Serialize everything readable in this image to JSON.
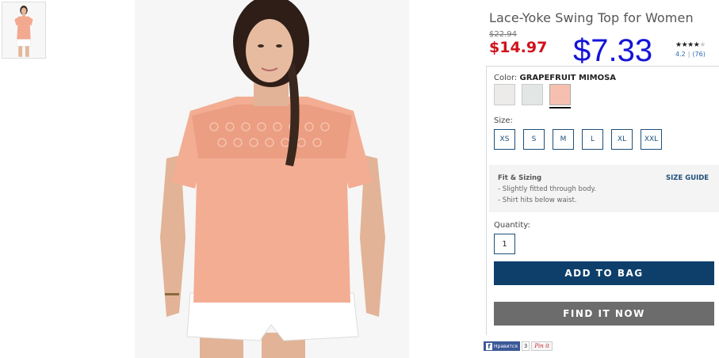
{
  "product": {
    "title": "Lace-Yoke Swing Top for Women",
    "original_price": "$22.94",
    "sale_price": "$14.97",
    "overlay_price": "$7.33",
    "rating": {
      "stars_filled": 4,
      "stars_total": 5,
      "average": "4.2",
      "count": "(76)"
    }
  },
  "color": {
    "label": "Color:",
    "selected": "GRAPEFRUIT MIMOSA",
    "swatches": [
      {
        "name": "white-swatch",
        "hex": "#ecebea"
      },
      {
        "name": "mint-swatch",
        "hex": "#e2e6e4"
      },
      {
        "name": "grapefruit-mimosa-swatch",
        "hex": "#f6c0b0"
      }
    ]
  },
  "size": {
    "label": "Size:",
    "options": [
      "XS",
      "S",
      "M",
      "L",
      "XL",
      "XXL"
    ]
  },
  "fit": {
    "title": "Fit & Sizing",
    "lines": [
      "- Slightly fitted through body.",
      "- Shirt hits below waist."
    ],
    "guide_link": "SIZE GUIDE"
  },
  "quantity": {
    "label": "Quantity:",
    "value": "1"
  },
  "buttons": {
    "add_to_bag": "ADD TO BAG",
    "find_it_now": "FIND IT NOW"
  },
  "social": {
    "facebook_label": "Нравится",
    "facebook_icon": "facebook-icon",
    "count": "3",
    "pinterest_label": "Pin it"
  },
  "colors": {
    "sale_red": "#d0121b",
    "overlay_blue": "#1414d8",
    "brand_navy": "#0e3f6b",
    "find_gray": "#6c6c6c"
  }
}
